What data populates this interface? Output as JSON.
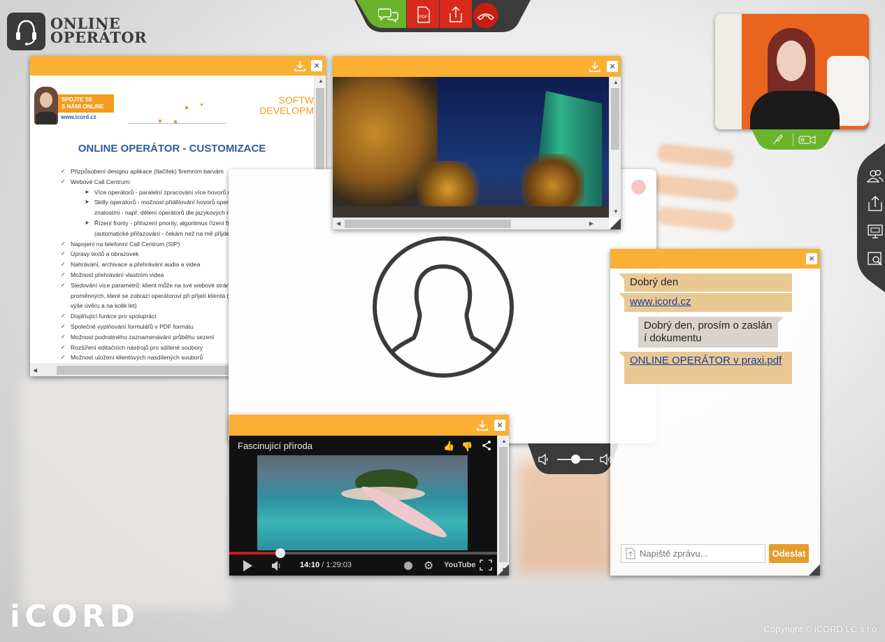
{
  "app": {
    "brand_line1": "ONLINE",
    "brand_line2": "OPERÁTOR",
    "footer_logo": "iCORD",
    "copyright": "Copyright © iCORD LC s.r.o."
  },
  "top_toolbar": {
    "icons": [
      "chat-icon",
      "pdf-icon",
      "upload-icon",
      "hangup-icon"
    ],
    "colors": {
      "green": "#6ab42d",
      "red": "#d9291c",
      "dark": "#3b3b3b"
    }
  },
  "video_controls": {
    "icons": [
      "microphone-icon",
      "camera-icon"
    ]
  },
  "side_toolbar": {
    "icons": [
      "users-icon",
      "upload-icon",
      "screen-share-icon",
      "search-document-icon"
    ]
  },
  "doc_window": {
    "banner_line1": "SPOJTE SE",
    "banner_line2": "S NÁMI ONLINE",
    "banner_url": "www.icord.cz",
    "side_text1": "SOFTW",
    "side_text2": "DEVELOPM",
    "title": "ONLINE OPERÁTOR - CUSTOMIZACE",
    "items": [
      {
        "text": "Přizpůsobení designu aplikace (tlačítek) firemním barvám",
        "sub": false
      },
      {
        "text": "Webové Call Centrum:",
        "sub": false
      },
      {
        "text": "Více operátorů - paralelní zpracování více hovorů najednou",
        "sub": true
      },
      {
        "text": "Skilly operátorů - možnost přidělování hovorů operátorovi s příslušnými znalostmi - např. dělení operátorů dle jazykových mutací",
        "sub": true
      },
      {
        "text": "Řízení fronty - přiřazení priority, algoritmus řízení fronty operátorů: FIFO (automatické přiřazování - čekám než na mě přijde řada)",
        "sub": true
      },
      {
        "text": "Napojení na telefonní Call Centrum (SIP)",
        "sub": false
      },
      {
        "text": "Úpravy textů a obrazovek",
        "sub": false
      },
      {
        "text": "Nahrávání, archivace a přehrávání audia a videa",
        "sub": false
      },
      {
        "text": "Možnost přehrávání vlastním videa",
        "sub": false
      },
      {
        "text": "Sledování více parametrů: klient může na své webové stránce definovat libovolný počet proměnných, které se zobrazí operátorovi při přijetí klienta (př. Hypoteční kalkulačka - výše úvěru a na kolik let)",
        "sub": false
      },
      {
        "text": "Doplňující funkce pro spolupráci",
        "sub": false
      },
      {
        "text": "Společné vyplňování formulářů v PDF formátu",
        "sub": false
      },
      {
        "text": "Možnost podrobného zaznamenávání průběhu sezení",
        "sub": false
      },
      {
        "text": "Rozšíření editačních nástrojů pro sdílené soubory",
        "sub": false
      },
      {
        "text": "Možnost uložení klientových nasdílených souborů",
        "sub": false
      }
    ],
    "close_label": "×"
  },
  "image_window": {
    "close_label": "×"
  },
  "youtube_window": {
    "title": "Fascinující příroda",
    "time_current": "14:10",
    "time_sep": " / ",
    "time_total": "1:29:03",
    "youtube_label": "YouTube",
    "progress": 0.19,
    "close_label": "×"
  },
  "volume": {
    "level": 0.5
  },
  "chat": {
    "messages": [
      {
        "dir": "in",
        "text": "Dobrý den"
      },
      {
        "dir": "in",
        "text": "www.icord.cz",
        "link": true
      },
      {
        "dir": "out",
        "text": "Dobrý den, prosím o zaslání dokumentu"
      },
      {
        "dir": "in",
        "text": "ONLINE OPERÁTOR v praxi.pdf",
        "link": true
      }
    ],
    "input_placeholder": "Napiště zprávu...",
    "send_label": "Odeslat",
    "close_label": "×"
  }
}
